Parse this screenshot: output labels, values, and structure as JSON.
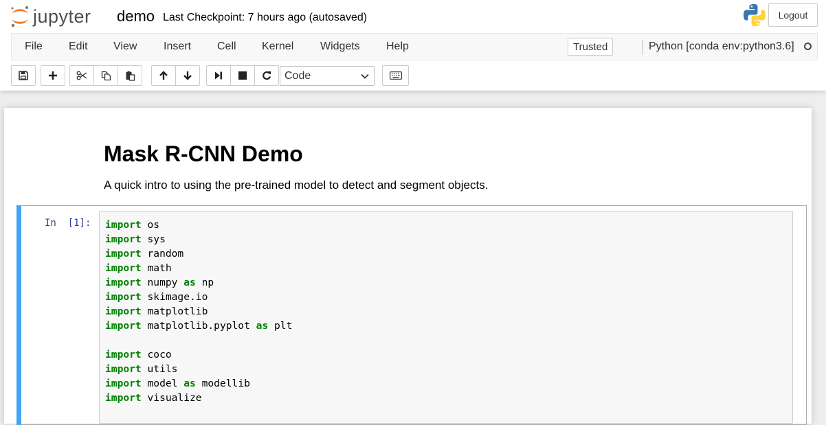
{
  "header": {
    "logo_text": "jupyter",
    "notebook_name": "demo",
    "checkpoint": "Last Checkpoint: 7 hours ago (autosaved)",
    "logout_label": "Logout"
  },
  "menubar": {
    "items": [
      "File",
      "Edit",
      "View",
      "Insert",
      "Cell",
      "Kernel",
      "Widgets",
      "Help"
    ],
    "trusted_label": "Trusted",
    "kernel_name": "Python [conda env:python3.6]"
  },
  "toolbar": {
    "cell_type": "Code",
    "icons": [
      "save-icon",
      "plus-icon",
      "scissors-icon",
      "copy-icon",
      "paste-icon",
      "arrow-up-icon",
      "arrow-down-icon",
      "step-forward-icon",
      "stop-icon",
      "refresh-icon",
      "keyboard-icon"
    ]
  },
  "notebook": {
    "markdown": {
      "title": "Mask R-CNN Demo",
      "intro": "A quick intro to using the pre-trained model to detect and segment objects."
    },
    "code_cell": {
      "prompt": "In  [1]:",
      "lines": [
        [
          {
            "t": "import",
            "k": 1
          },
          {
            "t": " os",
            "k": 0
          }
        ],
        [
          {
            "t": "import",
            "k": 1
          },
          {
            "t": " sys",
            "k": 0
          }
        ],
        [
          {
            "t": "import",
            "k": 1
          },
          {
            "t": " random",
            "k": 0
          }
        ],
        [
          {
            "t": "import",
            "k": 1
          },
          {
            "t": " math",
            "k": 0
          }
        ],
        [
          {
            "t": "import",
            "k": 1
          },
          {
            "t": " numpy ",
            "k": 0
          },
          {
            "t": "as",
            "k": 1
          },
          {
            "t": " np",
            "k": 0
          }
        ],
        [
          {
            "t": "import",
            "k": 1
          },
          {
            "t": " skimage.io",
            "k": 0
          }
        ],
        [
          {
            "t": "import",
            "k": 1
          },
          {
            "t": " matplotlib",
            "k": 0
          }
        ],
        [
          {
            "t": "import",
            "k": 1
          },
          {
            "t": " matplotlib.pyplot ",
            "k": 0
          },
          {
            "t": "as",
            "k": 1
          },
          {
            "t": " plt",
            "k": 0
          }
        ],
        [],
        [
          {
            "t": "import",
            "k": 1
          },
          {
            "t": " coco",
            "k": 0
          }
        ],
        [
          {
            "t": "import",
            "k": 1
          },
          {
            "t": " utils",
            "k": 0
          }
        ],
        [
          {
            "t": "import",
            "k": 1
          },
          {
            "t": " model ",
            "k": 0
          },
          {
            "t": "as",
            "k": 1
          },
          {
            "t": " modellib",
            "k": 0
          }
        ],
        [
          {
            "t": "import",
            "k": 1
          },
          {
            "t": " visualize",
            "k": 0
          }
        ]
      ]
    }
  },
  "colors": {
    "keyword": "#008000",
    "prompt": "#303f9f",
    "cell_selected_bar": "#42a5f5",
    "jupyter_orange": "#f37726"
  }
}
